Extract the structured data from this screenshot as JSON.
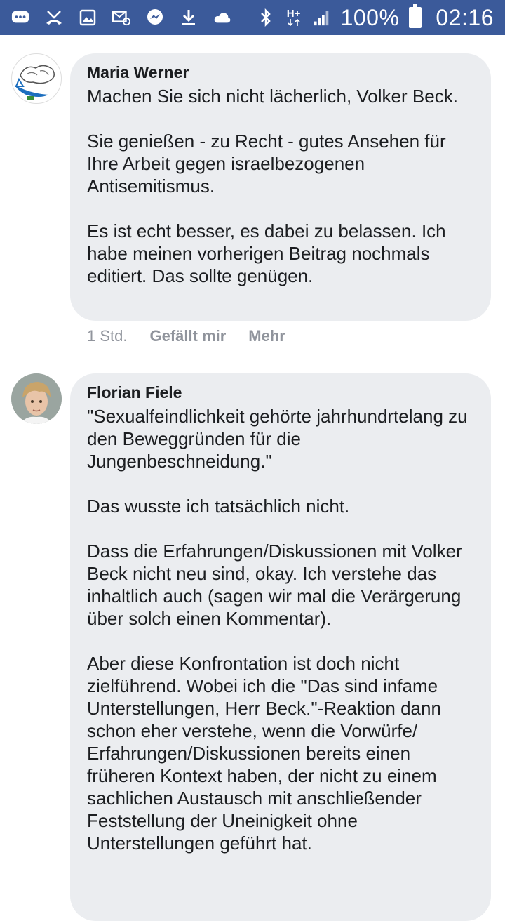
{
  "status_bar": {
    "battery": "100%",
    "time": "02:16",
    "network": "H+",
    "left_icons": [
      "message-icon",
      "missed-call-icon",
      "gallery-icon",
      "email-icon",
      "messenger-icon",
      "download-icon",
      "cloud-icon"
    ],
    "right_icons": [
      "bluetooth-icon",
      "network-icon",
      "signal-icon",
      "battery-icon"
    ]
  },
  "comments": [
    {
      "author": "Maria Werner",
      "text": "Machen Sie sich nicht lächerlich, Volker Beck.\n\nSie genießen - zu Recht - gutes Ansehen für Ihre Arbeit gegen israelbezogenen Antisemitismus.\n\nEs ist echt besser, es dabei zu belassen. Ich habe meinen vorherigen Beitrag nochmals editiert. Das sollte genügen.",
      "time": "1 Std.",
      "like": "Gefällt mir",
      "more": "Mehr"
    },
    {
      "author": "Florian Fiele",
      "text": "\"Sexualfeindlichkeit gehörte jahrhundrtelang zu den Beweggründen für die Jungenbeschneidung.\"\n\nDas wusste ich tatsächlich nicht.\n\nDass die Erfahrungen/Diskussionen mit Volker Beck nicht neu sind, okay. Ich verstehe das inhaltlich auch (sagen wir mal die Verärgerung über solch einen Kommentar).\n\nAber diese Konfrontation ist doch nicht zielführend. Wobei ich die \"Das sind infame Unterstellungen, Herr Beck.\"-Reaktion dann schon eher verstehe, wenn die Vorwürfe/ Erfahrungen/Diskussionen bereits einen früheren Kontext haben, der nicht zu einem sachlichen Austausch mit anschließender Feststellung der Uneinigkeit ohne Unterstellungen geführt hat."
    }
  ],
  "colors": {
    "status_bar": "#3b5a9a",
    "bubble": "#ebedf0",
    "meta": "#90949c"
  }
}
